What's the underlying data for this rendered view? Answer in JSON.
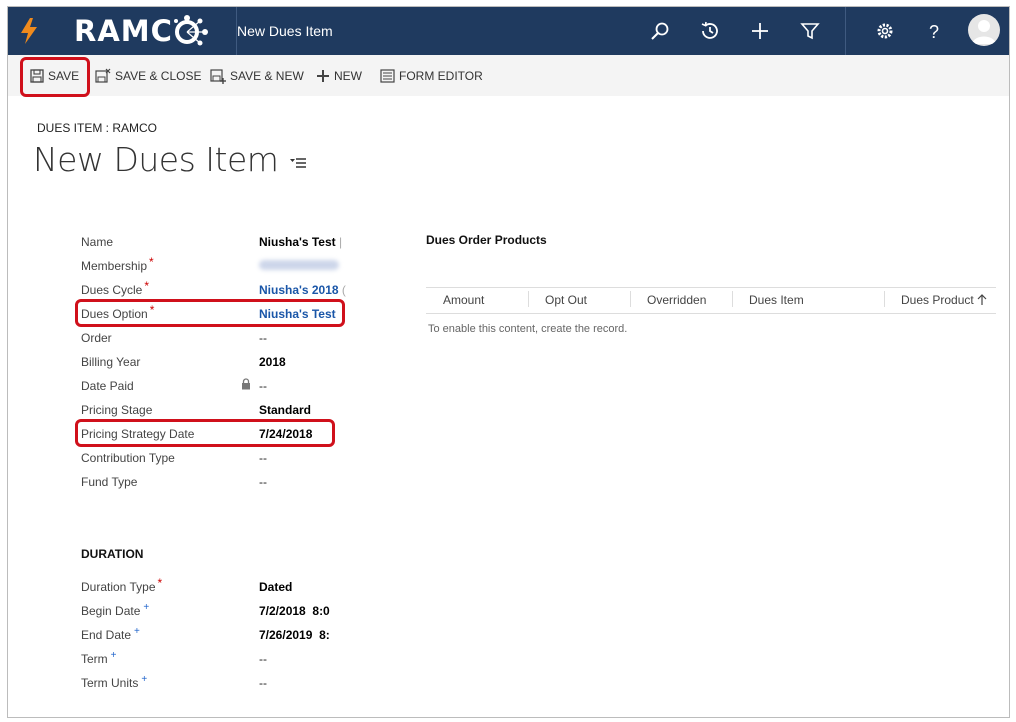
{
  "app": {
    "brand": "RAMC",
    "title": "New Dues Item"
  },
  "commands": {
    "save": "SAVE",
    "save_close": "SAVE & CLOSE",
    "save_new": "SAVE & NEW",
    "new": "NEW",
    "form_editor": "FORM EDITOR"
  },
  "header": {
    "entity_label": "DUES ITEM : RAMCO",
    "title": "New Dues Item"
  },
  "fields": {
    "name": {
      "label": "Name",
      "value": "Niusha's Test"
    },
    "membership": {
      "label": "Membership"
    },
    "dues_cycle": {
      "label": "Dues Cycle",
      "value": "Niusha's 2018"
    },
    "dues_option": {
      "label": "Dues Option",
      "value": "Niusha's Test"
    },
    "order": {
      "label": "Order",
      "value": "--"
    },
    "billing_year": {
      "label": "Billing Year",
      "value": "2018"
    },
    "date_paid": {
      "label": "Date Paid",
      "value": "--"
    },
    "pricing_stage": {
      "label": "Pricing Stage",
      "value": "Standard"
    },
    "pricing_strategy_date": {
      "label": "Pricing Strategy Date",
      "value": "7/24/2018"
    },
    "contribution_type": {
      "label": "Contribution Type",
      "value": "--"
    },
    "fund_type": {
      "label": "Fund Type",
      "value": "--"
    }
  },
  "duration": {
    "heading": "DURATION",
    "duration_type": {
      "label": "Duration Type",
      "value": "Dated"
    },
    "begin_date": {
      "label": "Begin Date",
      "value": "7/2/2018",
      "time": "8:0"
    },
    "end_date": {
      "label": "End Date",
      "value": "7/26/2019",
      "time": "8:"
    },
    "term": {
      "label": "Term",
      "value": "--"
    },
    "term_units": {
      "label": "Term Units",
      "value": "--"
    }
  },
  "grid": {
    "title": "Dues Order Products",
    "columns": [
      "Amount",
      "Opt Out",
      "Overridden",
      "Dues Item",
      "Dues Product"
    ],
    "empty_message": "To enable this content, create the record."
  },
  "colors": {
    "topbar": "#1f3a5f",
    "accent_orange": "#f08a1c",
    "highlight_red": "#d0101b",
    "link_blue": "#1a56a8"
  }
}
